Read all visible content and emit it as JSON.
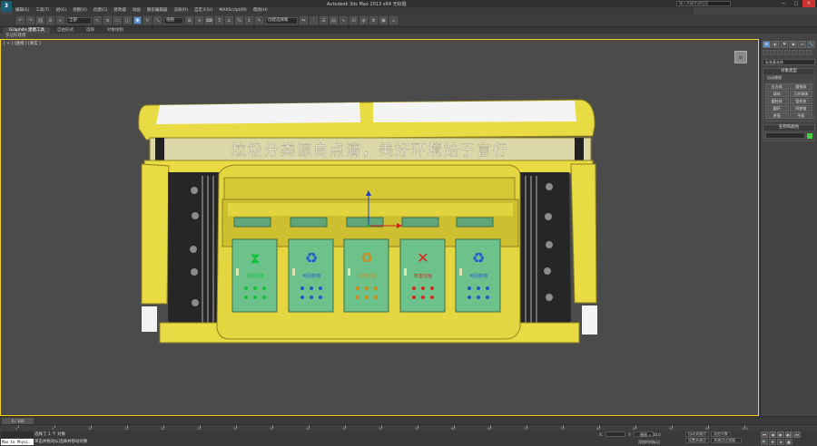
{
  "window": {
    "title": "Autodesk 3ds Max  2013 x64   无标题",
    "search_placeholder": "键入关键字或短语",
    "min": "—",
    "max": "□",
    "close": "✕"
  },
  "app_button": "3",
  "menu": [
    "编辑(E)",
    "工具(T)",
    "组(G)",
    "视图(V)",
    "创建(C)",
    "修改器",
    "动画",
    "图形编辑器",
    "渲染(R)",
    "自定义(U)",
    "MAXScript(M)",
    "帮助(H)"
  ],
  "toolbar": {
    "filter_dropdown": "全部",
    "refcoord_dropdown": "视图",
    "named_set_dropdown": "创建选择集"
  },
  "ribbon": {
    "tabs": [
      "Graphite 建模工具",
      "自由形式",
      "选择",
      "对象绘制"
    ],
    "active_tab": 0,
    "strip_label": "多边形建模"
  },
  "viewport": {
    "label": "[ + ] [透视 ] [真实 ]",
    "viewcube_face": "前",
    "sign_text": "垃圾分类源自点滴，美好环境始于言行",
    "bins": [
      {
        "label": "厨余垃圾",
        "color": "#14c23a",
        "symbol": "⧗"
      },
      {
        "label": "可回收物",
        "color": "#1e59c8",
        "symbol": "♻"
      },
      {
        "label": "其他垃圾",
        "color": "#d48a19",
        "symbol": "♻"
      },
      {
        "label": "有害垃圾",
        "color": "#d8271d",
        "symbol": "✕"
      },
      {
        "label": "可回收物",
        "color": "#1e59c8",
        "symbol": "♻"
      }
    ],
    "colors": {
      "frame": "#e9db43",
      "frame_dark": "#c9b72b",
      "panel": "#6cc28a",
      "border": "#f5d21a"
    }
  },
  "command_panel": {
    "tabs": [
      "✹",
      "◐",
      "⚑",
      "◉",
      "▭",
      "🔧"
    ],
    "category_dropdown": "标准基本体",
    "object_type": {
      "title": "对象类型",
      "autogrid": "自动栅格",
      "buttons": [
        "长方体",
        "圆锥体",
        "球体",
        "几何球体",
        "圆柱体",
        "管状体",
        "圆环",
        "四棱锥",
        "茶壶",
        "平面"
      ]
    },
    "name_color": {
      "title": "名称和颜色"
    }
  },
  "timeline": {
    "slider": "0 / 100",
    "ticks": [
      "0",
      "5",
      "10",
      "15",
      "20",
      "25",
      "30",
      "35",
      "40",
      "45",
      "50",
      "55",
      "60",
      "65",
      "70",
      "75",
      "80",
      "85",
      "90",
      "95",
      "100"
    ]
  },
  "status": {
    "lock": "",
    "maxscript": "Max to Physc.",
    "selection": "选择了 1 个 对象",
    "prompt": "单击并拖动以选择并移动对象",
    "x_label": "X:",
    "y_label": "Y:",
    "z_label": "Z:",
    "grid": "栅格 = 10.0",
    "add_time_tag": "添加时间标记",
    "autokey": "自动关键点",
    "selected_dropdown": "选定对象",
    "setkey": "设置关键点",
    "key_filters": "关键点过滤器...",
    "frame": "0",
    "play": [
      "⏮",
      "◀",
      "▶",
      "▶|",
      "⏭"
    ],
    "nav": [
      "🔍",
      "✥",
      "⊕",
      "▣"
    ]
  }
}
